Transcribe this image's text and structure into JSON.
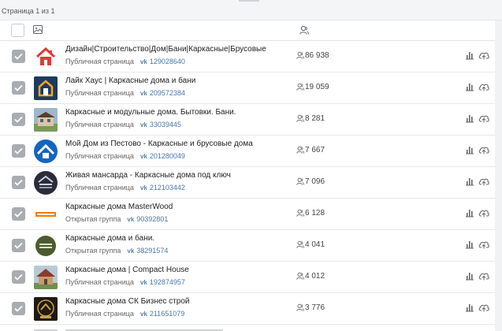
{
  "pagination": {
    "text": "Страница 1 из 1"
  },
  "rows": [
    {
      "title": "Дизайн|Строительство|Дом|Бани|Каркасные|Брусовые",
      "type": "Публичная страница",
      "vk_id": "129028640",
      "members": "86 938",
      "avatar": "red-house-logo"
    },
    {
      "title": "Лайк Хаус | Каркасные дома и бани",
      "type": "Публичная страница",
      "vk_id": "209572384",
      "members": "19 059",
      "avatar": "like-house-logo"
    },
    {
      "title": "Каркасные и модульные дома. Бытовки. Бани.",
      "type": "Публичная страница",
      "vk_id": "33039445",
      "members": "8 281",
      "avatar": "modular-house-photo"
    },
    {
      "title": "Мой Дом из Пестово - Каркасные и брусовые дома",
      "type": "Публичная страница",
      "vk_id": "201280049",
      "members": "7 667",
      "avatar": "blue-roof-logo"
    },
    {
      "title": "Живая мансарда - Каркасные дома под ключ",
      "type": "Публичная страница",
      "vk_id": "212103442",
      "members": "7 096",
      "avatar": "mansard-logo"
    },
    {
      "title": "Каркасные дома MasterWood",
      "type": "Открытая группа",
      "vk_id": "90392801",
      "members": "6 128",
      "avatar": "masterwood-logo"
    },
    {
      "title": "Каркасные дома и бани.",
      "type": "Открытая группа",
      "vk_id": "38291574",
      "members": "4 041",
      "avatar": "doma-bani-logo"
    },
    {
      "title": "Каркасные дома | Compact House",
      "type": "Публичная страница",
      "vk_id": "192874957",
      "members": "4 012",
      "avatar": "compact-house-photo"
    },
    {
      "title": "Каркасные дома СК Бизнес строй",
      "type": "Публичная страница",
      "vk_id": "211651079",
      "members": "3 776",
      "avatar": "biznes-stroy-logo"
    }
  ],
  "colors": {
    "link": "#4a76a8",
    "checkbox": "#a9adb2",
    "accent_red": "#e53935"
  },
  "icons": {
    "header_image": "image-icon",
    "header_members": "user-icon",
    "stats": "bar-chart-icon",
    "upload": "cloud-upload-icon"
  }
}
